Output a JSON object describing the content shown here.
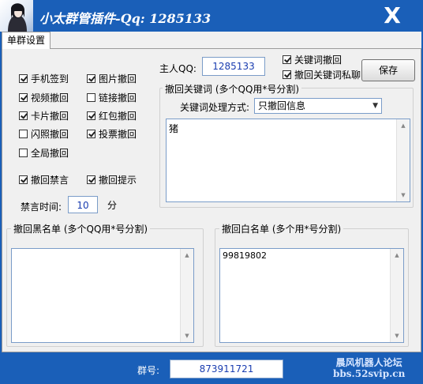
{
  "window": {
    "title": "小太群管插件-Qq: 1285133",
    "close_label": "X"
  },
  "tab": {
    "label": "单群设置"
  },
  "features": [
    {
      "label": "手机签到",
      "checked": true
    },
    {
      "label": "图片撤回",
      "checked": true
    },
    {
      "label": "视频撤回",
      "checked": true
    },
    {
      "label": "链接撤回",
      "checked": false
    },
    {
      "label": "卡片撤回",
      "checked": true
    },
    {
      "label": "红包撤回",
      "checked": true
    },
    {
      "label": "闪照撤回",
      "checked": false
    },
    {
      "label": "投票撤回",
      "checked": true
    },
    {
      "label": "全局撤回",
      "checked": false
    },
    {
      "label": "撤回禁言",
      "checked": true
    },
    {
      "label": "撤回提示",
      "checked": true
    }
  ],
  "mute": {
    "label": "禁言时间:",
    "value": "10",
    "unit": "分"
  },
  "owner": {
    "label": "主人QQ:",
    "value": "1285133"
  },
  "keyword_options": [
    {
      "label": "关键词撤回",
      "checked": true
    },
    {
      "label": "撤回关键词私聊",
      "checked": true
    }
  ],
  "save_label": "保存",
  "keywords": {
    "title": "撤回关键词 (多个QQ用*号分割)",
    "method_label": "关键词处理方式:",
    "method_value": "只撤回信息",
    "content": "猪"
  },
  "blacklist": {
    "title": "撤回黑名单 (多个QQ用*号分割)",
    "content": ""
  },
  "whitelist": {
    "title": "撤回白名单 (多个用*号分割)",
    "content": "99819802"
  },
  "group": {
    "label": "群号:",
    "value": "873911721"
  },
  "watermark": {
    "line1": "晨风机器人论坛",
    "line2": "bbs.52svip.cn"
  }
}
